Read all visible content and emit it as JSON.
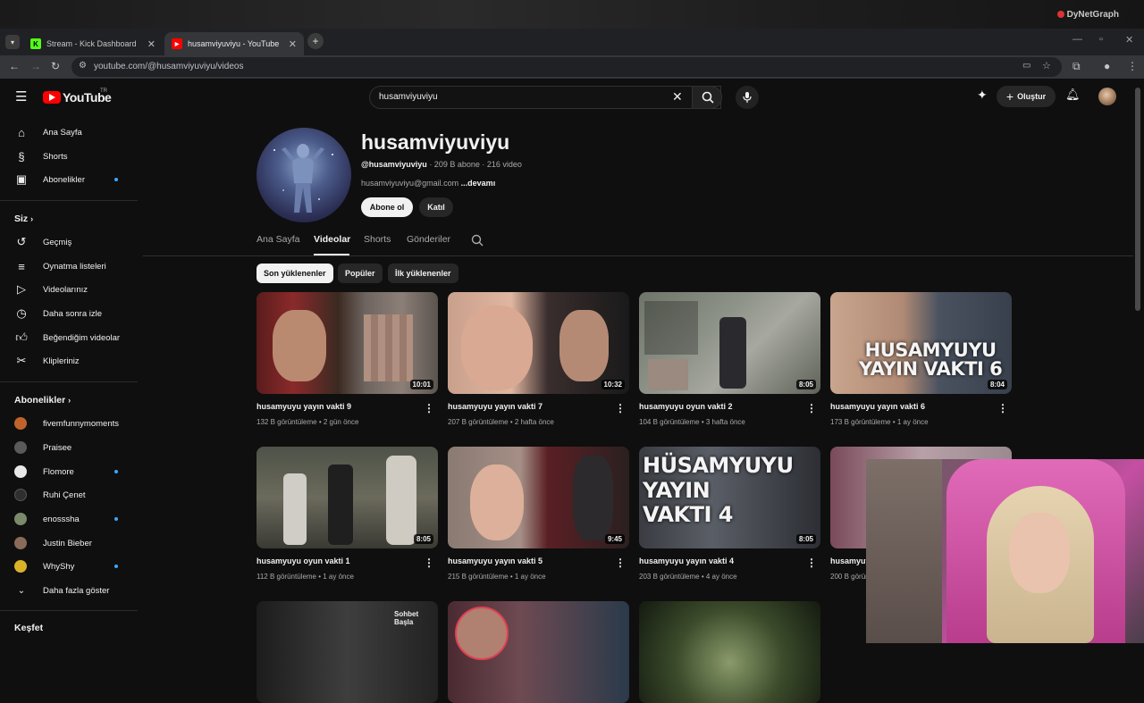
{
  "watermark": "DyNetGraph",
  "browser": {
    "tabs": [
      {
        "label": "Stream - Kick Dashboard",
        "favicon": "K"
      },
      {
        "label": "husamviyuviyu - YouTube",
        "favicon": "▶"
      }
    ],
    "url": "youtube.com/@husamviyuviyu/videos"
  },
  "header": {
    "logo_text": "YouTube",
    "country_code": "TR",
    "search_value": "husamviyuviyu",
    "create_label": "Oluştur"
  },
  "sidebar": {
    "main": [
      {
        "label": "Ana Sayfa",
        "icon": "home-icon"
      },
      {
        "label": "Shorts",
        "icon": "shorts-icon"
      },
      {
        "label": "Abonelikler",
        "icon": "subscriptions-icon"
      }
    ],
    "you_title": "Siz",
    "you": [
      {
        "label": "Geçmiş",
        "icon": "history-icon"
      },
      {
        "label": "Oynatma listeleri",
        "icon": "playlists-icon"
      },
      {
        "label": "Videolarınız",
        "icon": "your-videos-icon"
      },
      {
        "label": "Daha sonra izle",
        "icon": "watch-later-icon"
      },
      {
        "label": "Beğendiğim videolar",
        "icon": "liked-icon"
      },
      {
        "label": "Klipleriniz",
        "icon": "clips-icon"
      }
    ],
    "subs_title": "Abonelikler",
    "subs": [
      {
        "label": "fivemfunnymoments",
        "color": "#c0632b"
      },
      {
        "label": "Praisee",
        "color": "#5a5a5a"
      },
      {
        "label": "Flomore",
        "color": "#e8e8e8"
      },
      {
        "label": "Ruhi Çenet",
        "color": "#2f2f2f"
      },
      {
        "label": "enosssha",
        "color": "#7a8a6a"
      },
      {
        "label": "Justin Bieber",
        "color": "#8a6a5a"
      },
      {
        "label": "WhyShy",
        "color": "#d9b22a"
      }
    ],
    "show_more": "Daha fazla göster",
    "explore_title": "Keşfet"
  },
  "channel": {
    "name": "husamviyuviyu",
    "handle": "@husamviyuviyu",
    "stats": " · 209 B abone · 216 video",
    "desc": "husamviyuviyu@gmail.com ",
    "more": "...devamı",
    "subscribe": "Abone ol",
    "join": "Katıl",
    "tabs": [
      "Ana Sayfa",
      "Videolar",
      "Shorts",
      "Gönderiler"
    ],
    "chips": [
      "Son yüklenenler",
      "Popüler",
      "İlk yüklenenler"
    ]
  },
  "videos": [
    {
      "title": "husamyuyu yayın vakti 9",
      "meta": "132 B görüntüleme • 2 gün önce",
      "duration": "10:01",
      "overlay": ""
    },
    {
      "title": "husamyuyu yayın vakti 7",
      "meta": "207 B görüntüleme • 2 hafta önce",
      "duration": "10:32",
      "overlay": ""
    },
    {
      "title": "husamyuyu oyun vakti 2",
      "meta": "104 B görüntüleme • 3 hafta önce",
      "duration": "8:05",
      "overlay": ""
    },
    {
      "title": "husamyuyu yayın vakti 6",
      "meta": "173 B görüntüleme • 1 ay önce",
      "duration": "8:04",
      "overlay": "HUSAMYUYU\nYAYIN VAKTI 6"
    },
    {
      "title": "husamyuyu oyun vakti 1",
      "meta": "112 B görüntüleme • 1 ay önce",
      "duration": "8:05",
      "overlay": ""
    },
    {
      "title": "husamyuyu yayın vakti 5",
      "meta": "215 B görüntüleme • 1 ay önce",
      "duration": "9:45",
      "overlay": ""
    },
    {
      "title": "husamyuyu yayın vakti 4",
      "meta": "203 B görüntüleme • 4 ay önce",
      "duration": "8:05",
      "overlay": "HÜSAMYUYU\nYAYIN\nVAKTI 4"
    },
    {
      "title": "husamyuy",
      "meta": "200 B görüntüleme",
      "duration": "",
      "overlay": ""
    }
  ],
  "row3_overlay": "Sohbet Başla"
}
